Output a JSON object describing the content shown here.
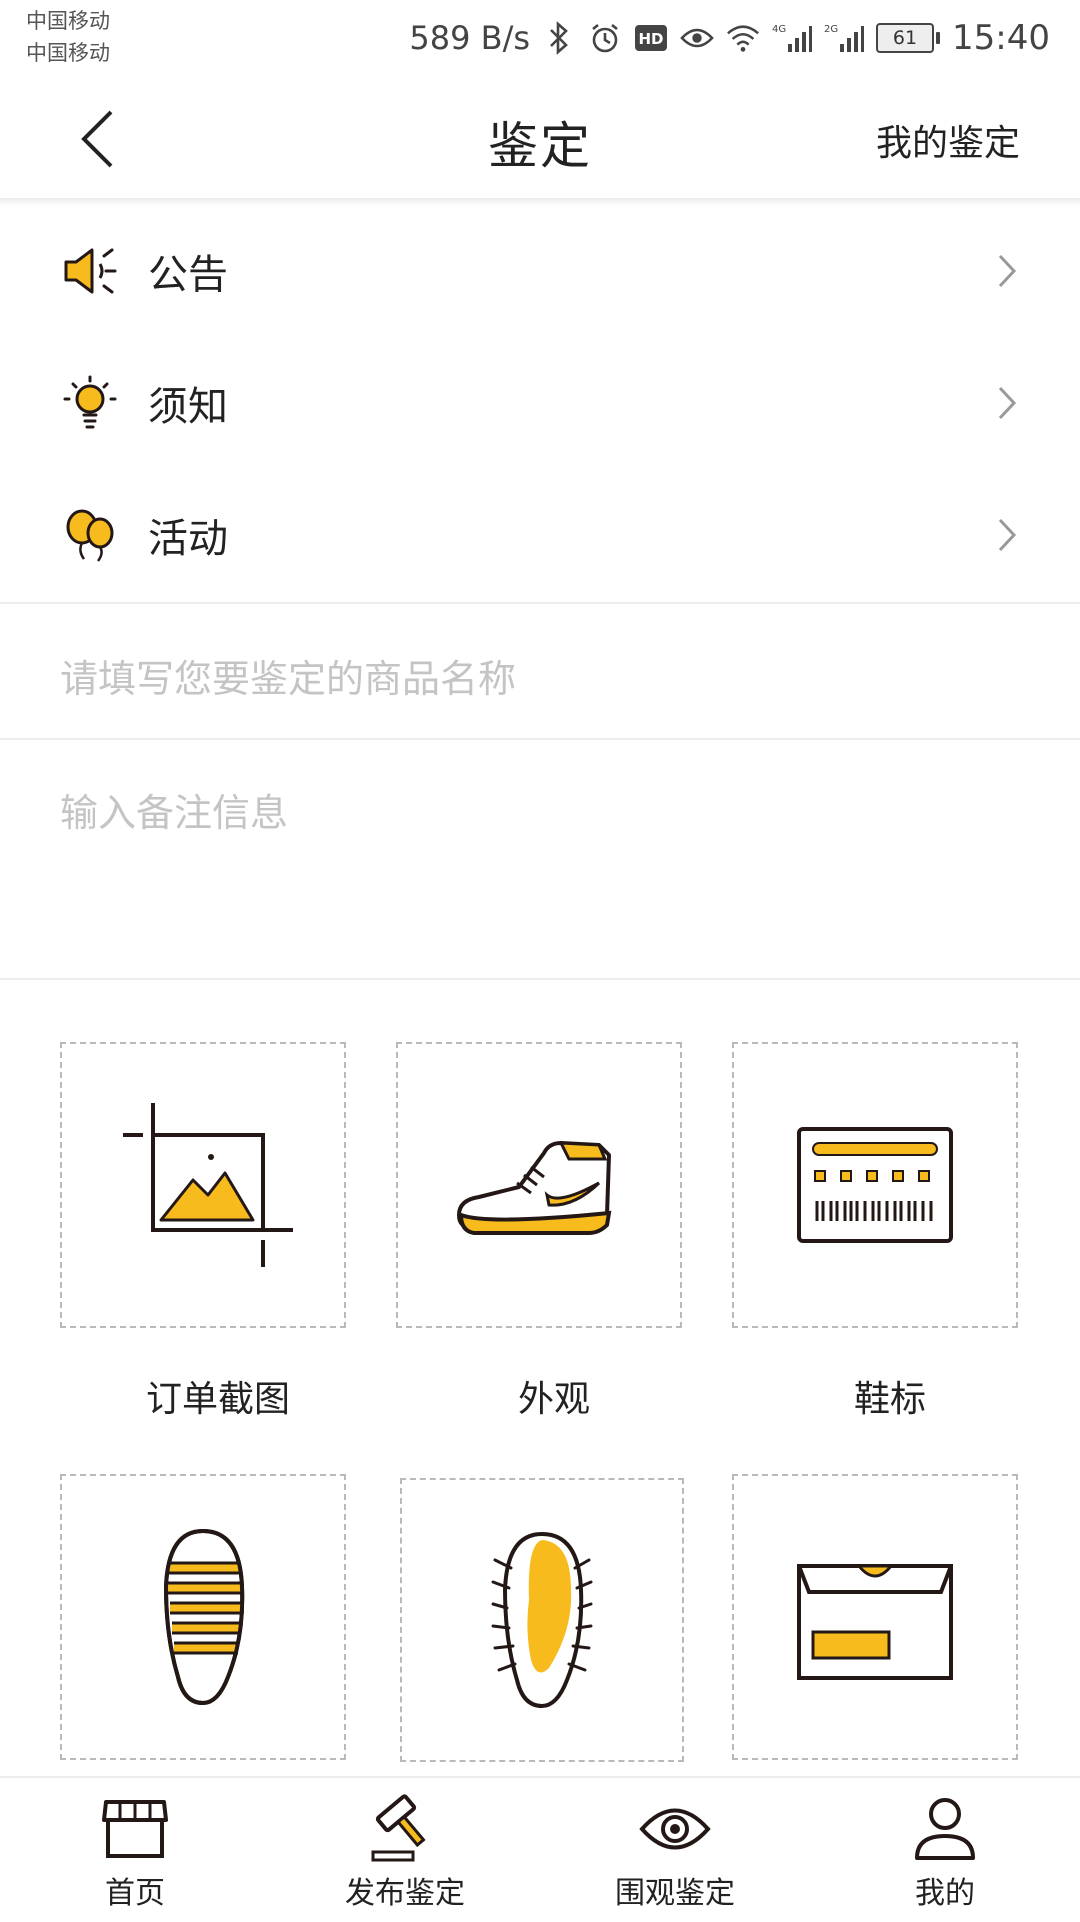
{
  "status_bar": {
    "carrier_1": "中国移动",
    "carrier_2": "中国移动",
    "net_speed": "589 B/s",
    "battery": "61",
    "time": "15:40",
    "icons": [
      "bluetooth-icon",
      "alarm-icon",
      "hd-icon",
      "eye-icon",
      "wifi-icon",
      "signal-4g-icon",
      "signal-2g-icon"
    ]
  },
  "nav": {
    "title": "鉴定",
    "right_link": "我的鉴定"
  },
  "menu": [
    {
      "label": "公告",
      "icon": "megaphone-icon"
    },
    {
      "label": "须知",
      "icon": "lightbulb-icon"
    },
    {
      "label": "活动",
      "icon": "balloons-icon"
    }
  ],
  "form": {
    "product_placeholder": "请填写您要鉴定的商品名称",
    "remark_placeholder": "输入备注信息"
  },
  "uploads": [
    {
      "label": "订单截图",
      "icon": "screenshot-crop-icon"
    },
    {
      "label": "外观",
      "icon": "sneaker-icon"
    },
    {
      "label": "鞋标",
      "icon": "shoe-tag-icon"
    },
    {
      "label": "",
      "icon": "shoe-sole-icon"
    },
    {
      "label": "",
      "icon": "insole-icon"
    },
    {
      "label": "",
      "icon": "shoebox-icon"
    }
  ],
  "tabs": [
    {
      "label": "首页",
      "icon": "store-icon"
    },
    {
      "label": "发布鉴定",
      "icon": "gavel-icon"
    },
    {
      "label": "围观鉴定",
      "icon": "eye-icon"
    },
    {
      "label": "我的",
      "icon": "user-icon"
    }
  ],
  "colors": {
    "accent": "#F7BB1D",
    "outline": "#231815",
    "placeholder": "#C4C4C4"
  }
}
